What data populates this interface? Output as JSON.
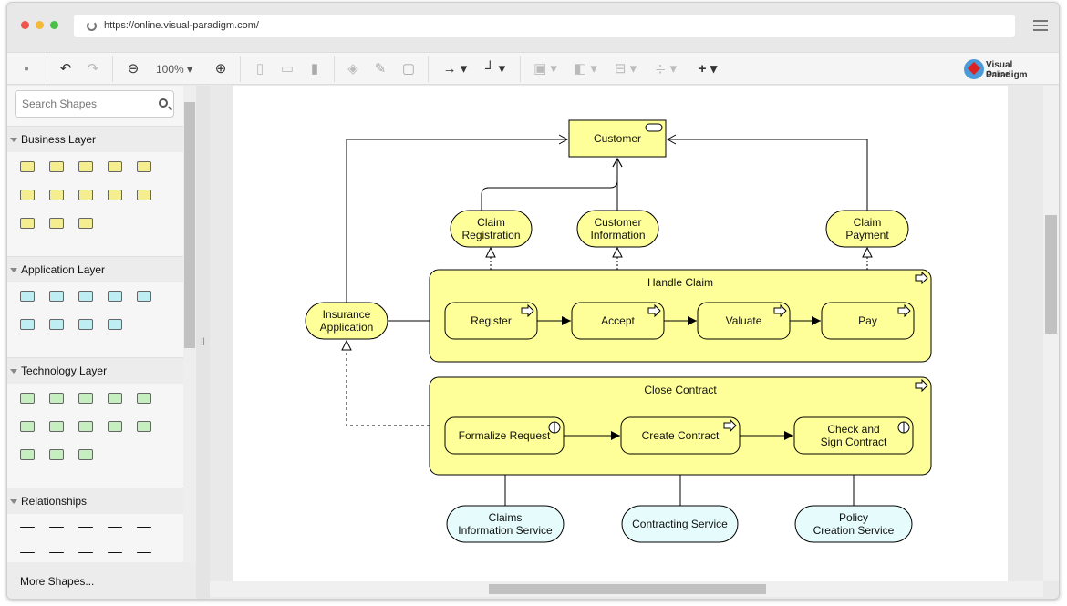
{
  "browser": {
    "url": "https://online.visual-paradigm.com/"
  },
  "toolbar": {
    "zoom": "100%",
    "logo_line1": "Visual Paradigm",
    "logo_line2": "Online",
    "icons": [
      "save-icon",
      "undo-icon",
      "redo-icon",
      "zoom-out-icon",
      "zoom-in-icon",
      "copy-icon",
      "paste-icon",
      "delete-icon",
      "fill-color-icon",
      "line-color-icon",
      "shadow-icon",
      "connector-style-icon",
      "waypoint-style-icon",
      "group-icon",
      "arrange-icon",
      "align-icon",
      "distribute-icon",
      "add-icon"
    ]
  },
  "sidebar": {
    "search_placeholder": "Search Shapes",
    "sections": [
      {
        "label": "Business Layer",
        "color": "#f5ee90"
      },
      {
        "label": "Application Layer",
        "color": "#bfeef2"
      },
      {
        "label": "Technology Layer",
        "color": "#c6eec0"
      },
      {
        "label": "Relationships",
        "color": "#ffffff"
      }
    ],
    "more_shapes": "More Shapes..."
  },
  "colors": {
    "business": "#ffff99",
    "service": "#e6fcfc",
    "stroke": "#000000"
  },
  "diagram": {
    "customer": "Customer",
    "claim_registration": [
      "Claim",
      "Registration"
    ],
    "customer_information": [
      "Customer",
      "Information"
    ],
    "claim_payment": [
      "Claim",
      "Payment"
    ],
    "insurance_application": [
      "Insurance",
      "Application"
    ],
    "handle_claim": "Handle Claim",
    "register": "Register",
    "accept": "Accept",
    "valuate": "Valuate",
    "pay": "Pay",
    "close_contract": "Close Contract",
    "formalize_request": "Formalize Request",
    "create_contract": "Create Contract",
    "check_sign": [
      "Check and",
      "Sign Contract"
    ],
    "claims_info_service": [
      "Claims",
      "Information Service"
    ],
    "contracting_service": "Contracting Service",
    "policy_creation_service": [
      "Policy",
      "Creation Service"
    ]
  }
}
